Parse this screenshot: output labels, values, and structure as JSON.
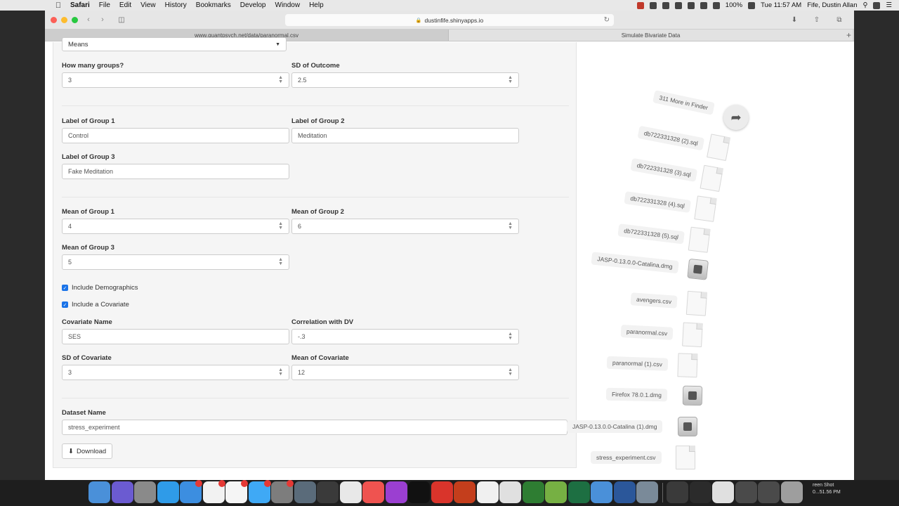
{
  "menubar": {
    "app": "Safari",
    "items": [
      "File",
      "Edit",
      "View",
      "History",
      "Bookmarks",
      "Develop",
      "Window",
      "Help"
    ],
    "battery": "100%",
    "clock": "Tue 11:57 AM",
    "user": "Fife, Dustin Allan"
  },
  "browser": {
    "url": "dustinfife.shinyapps.io",
    "tabs": [
      "www.quantpsych.net/data/paranormal.csv",
      "Simulate Bivariate Data"
    ]
  },
  "form": {
    "type_select": "Means",
    "groups_label": "How many groups?",
    "groups_value": "3",
    "sd_outcome_label": "SD of Outcome",
    "sd_outcome_value": "2.5",
    "group1_label": "Label of Group 1",
    "group1_value": "Control",
    "group2_label": "Label of Group 2",
    "group2_value": "Meditation",
    "group3_label": "Label of Group 3",
    "group3_value": "Fake Meditation",
    "mean1_label": "Mean of Group 1",
    "mean1_value": "4",
    "mean2_label": "Mean of Group 2",
    "mean2_value": "6",
    "mean3_label": "Mean of Group 3",
    "mean3_value": "5",
    "include_demographics": "Include Demographics",
    "include_covariate": "Include a Covariate",
    "cov_name_label": "Covariate Name",
    "cov_name_value": "SES",
    "corr_label": "Correlation with DV",
    "corr_value": "-.3",
    "sd_cov_label": "SD of Covariate",
    "sd_cov_value": "3",
    "mean_cov_label": "Mean of Covariate",
    "mean_cov_value": "12",
    "dataset_label": "Dataset Name",
    "dataset_value": "stress_experiment",
    "download_label": "Download"
  },
  "stack": {
    "more": "311 More in Finder",
    "files": [
      "db722331328 (2).sql",
      "db722331328 (3).sql",
      "db722331328 (4).sql",
      "db722331328 (5).sql",
      "JASP-0.13.0.0-Catalina.dmg",
      "avengers.csv",
      "paranormal.csv",
      "paranormal (1).csv",
      "Firefox 78.0.1.dmg",
      "JASP-0.13.0.0-Catalina (1).dmg",
      "stress_experiment.csv"
    ]
  },
  "dock": {
    "screenshot_label_1": "reen Shot",
    "screenshot_label_2": "0...51.56 PM"
  }
}
